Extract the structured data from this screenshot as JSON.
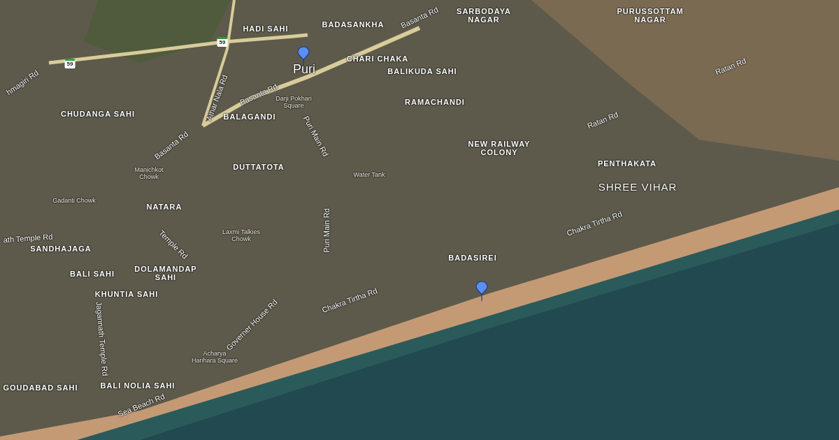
{
  "map": {
    "city": "Puri",
    "labels": [
      {
        "kind": "area",
        "text": "SARBODAYA NAGAR"
      },
      {
        "kind": "area",
        "text": "PURUSSOTTAM NAGAR"
      },
      {
        "kind": "road",
        "text": "Basanta Rd"
      },
      {
        "kind": "area",
        "text": "HADI SAHI"
      },
      {
        "kind": "area",
        "text": "BADASANKHA"
      },
      {
        "kind": "shield",
        "text": "59"
      },
      {
        "kind": "area",
        "text": "CHARI CHAKA"
      },
      {
        "kind": "shield",
        "text": "59"
      },
      {
        "kind": "road",
        "text": "Ratan Rd"
      },
      {
        "kind": "area",
        "text": "BALIKUDA SAHI"
      },
      {
        "kind": "road",
        "text": "hmagiri Rd"
      },
      {
        "kind": "road",
        "text": "Basanta Rd"
      },
      {
        "kind": "road",
        "text": "Athar Nala Rd"
      },
      {
        "kind": "area",
        "text": "RAMACHANDI"
      },
      {
        "kind": "poi",
        "text": "Darji Pokhari Square"
      },
      {
        "kind": "area",
        "text": "CHUDANGA SAHI"
      },
      {
        "kind": "area",
        "text": "BALAGANDI"
      },
      {
        "kind": "road",
        "text": "Ratan Rd"
      },
      {
        "kind": "road",
        "text": "Puri Main Rd"
      },
      {
        "kind": "road",
        "text": "Basanta Rd"
      },
      {
        "kind": "area",
        "text": "NEW RAILWAY COLONY"
      },
      {
        "kind": "area",
        "text": "PENTHAKATA"
      },
      {
        "kind": "area",
        "text": "DUTTATOTA"
      },
      {
        "kind": "poi",
        "text": "Manichkot Chowk"
      },
      {
        "kind": "poi",
        "text": "Water Tank"
      },
      {
        "kind": "major",
        "text": "SHREE VIHAR"
      },
      {
        "kind": "poi",
        "text": "Gadanti Chowk"
      },
      {
        "kind": "area",
        "text": "NATARA"
      },
      {
        "kind": "road",
        "text": "Chakra Tirtha Rd"
      },
      {
        "kind": "road",
        "text": "Puri Main Rd"
      },
      {
        "kind": "poi",
        "text": "Laxmi Talkies Chowk"
      },
      {
        "kind": "road",
        "text": "ath Temple Rd"
      },
      {
        "kind": "road",
        "text": "Temple Rd"
      },
      {
        "kind": "area",
        "text": "SANDHAJAGA"
      },
      {
        "kind": "area",
        "text": "BADASIREI"
      },
      {
        "kind": "area",
        "text": "BALI SAHI"
      },
      {
        "kind": "area",
        "text": "DOLAMANDAP SAHI"
      },
      {
        "kind": "area",
        "text": "KHUNTIA SAHI"
      },
      {
        "kind": "road",
        "text": "Chakra Tirtha Rd"
      },
      {
        "kind": "road",
        "text": "Governer House Rd"
      },
      {
        "kind": "road",
        "text": "Jagannath Temple Rd"
      },
      {
        "kind": "poi",
        "text": "Acharya Harihara Square"
      },
      {
        "kind": "area",
        "text": "GOUDABAD SAHI"
      },
      {
        "kind": "area",
        "text": "BALI NOLIA SAHI"
      },
      {
        "kind": "road",
        "text": "Sea Beach Rd"
      }
    ]
  }
}
